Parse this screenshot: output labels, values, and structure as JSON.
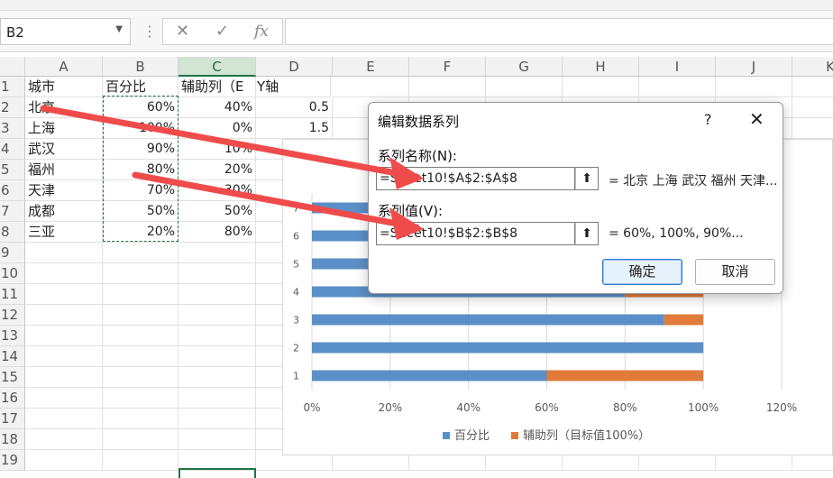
{
  "formula_bar": {
    "name_box": "B2",
    "fx_label": "fx"
  },
  "columns": [
    "A",
    "B",
    "C",
    "D",
    "E",
    "F",
    "G",
    "H",
    "I",
    "J",
    "K"
  ],
  "rows": [
    "1",
    "2",
    "3",
    "4",
    "5",
    "6",
    "7",
    "8",
    "9",
    "10",
    "11",
    "12",
    "13",
    "14",
    "15",
    "16",
    "17",
    "18",
    "19"
  ],
  "sheet": {
    "header": [
      "城市",
      "百分比",
      "辅助列（目标值100%）",
      "Y轴"
    ],
    "header_c_visible": "辅助列（E",
    "data": [
      {
        "city": "北京",
        "pct": "60%",
        "aux": "40%",
        "y": "0.5"
      },
      {
        "city": "上海",
        "pct": "100%",
        "aux": "0%",
        "y": "1.5"
      },
      {
        "city": "武汉",
        "pct": "90%",
        "aux": "10%",
        "y": ""
      },
      {
        "city": "福州",
        "pct": "80%",
        "aux": "20%",
        "y": ""
      },
      {
        "city": "天津",
        "pct": "70%",
        "aux": "30%",
        "y": ""
      },
      {
        "city": "成都",
        "pct": "50%",
        "aux": "50%",
        "y": ""
      },
      {
        "city": "三亚",
        "pct": "20%",
        "aux": "80%",
        "y": ""
      }
    ]
  },
  "dialog": {
    "title": "编辑数据系列",
    "help": "?",
    "close": "✕",
    "name_label": "系列名称(N):",
    "name_value": "=Sheet10!$A$2:$A$8",
    "name_preview": "= 北京 上海 武汉 福州 天津...",
    "values_label": "系列值(V):",
    "values_value": "=Sheet10!$B$2:$B$8",
    "values_preview": "= 60%, 100%, 90%...",
    "ok_label": "确定",
    "cancel_label": "取消"
  },
  "colors": {
    "series1": "#5b8fc7",
    "series2": "#e07b39",
    "arrow": "#ef4b4b",
    "excel_green": "#217346"
  },
  "chart_data": {
    "type": "bar",
    "orientation": "horizontal",
    "stacked": true,
    "categories": [
      "1",
      "2",
      "3",
      "4",
      "5",
      "6",
      "7"
    ],
    "series": [
      {
        "name": "百分比",
        "values": [
          0.6,
          1.0,
          0.9,
          0.8,
          0.7,
          0.5,
          0.2
        ]
      },
      {
        "name": "辅助列（目标值100%）",
        "values": [
          0.4,
          0.0,
          0.1,
          0.2,
          0.3,
          0.5,
          0.8
        ]
      }
    ],
    "x_ticks": [
      "0%",
      "20%",
      "40%",
      "60%",
      "80%",
      "100%",
      "120%"
    ],
    "xlim": [
      0,
      1.2
    ],
    "grid": "vertical",
    "legend": "bottom"
  }
}
